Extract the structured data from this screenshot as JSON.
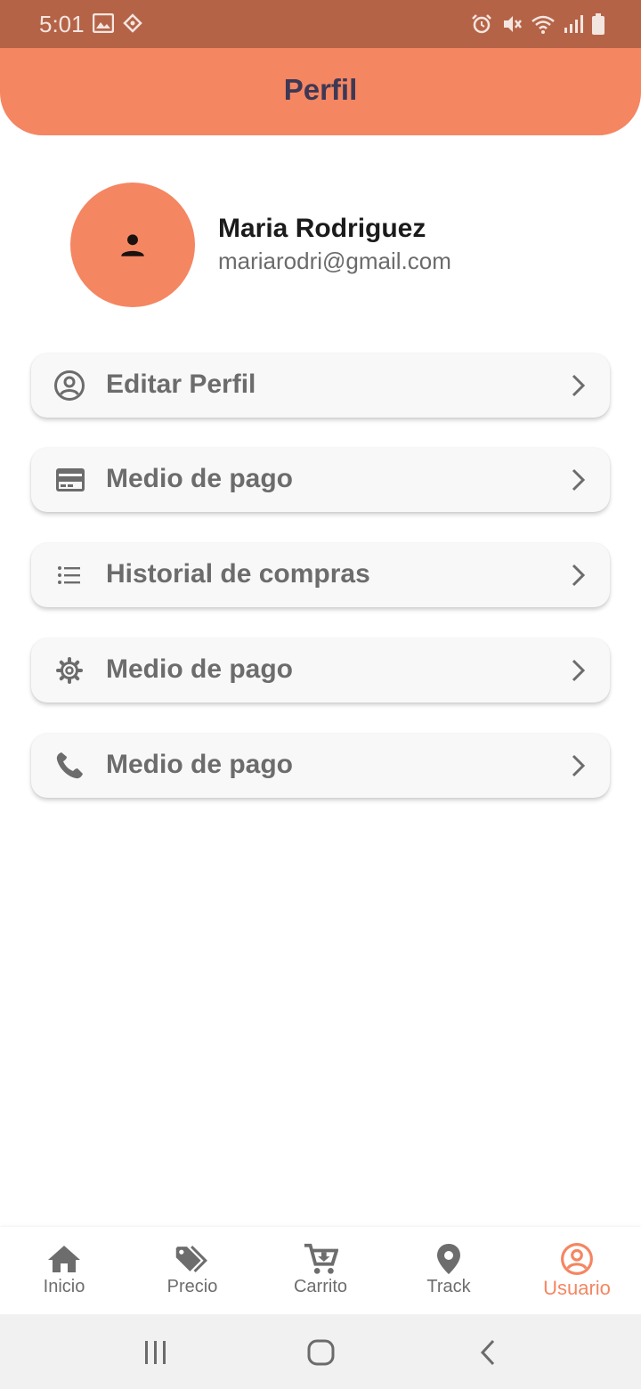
{
  "status_bar": {
    "time": "5:01",
    "left_icons": [
      "image-icon",
      "diamond-icon"
    ],
    "right_icons": [
      "alarm-icon",
      "mute-icon",
      "wifi-icon",
      "signal-icon",
      "battery-icon"
    ]
  },
  "header": {
    "title": "Perfil"
  },
  "profile": {
    "name": "Maria Rodriguez",
    "email": "mariarodri@gmail.com",
    "avatar_icon": "person-icon"
  },
  "menu": [
    {
      "label": "Editar Perfil",
      "icon": "account-circle-icon"
    },
    {
      "label": "Medio de pago",
      "icon": "credit-card-icon"
    },
    {
      "label": "Historial de compras",
      "icon": "list-icon"
    },
    {
      "label": "Medio de pago",
      "icon": "gear-icon"
    },
    {
      "label": "Medio de pago",
      "icon": "phone-icon"
    }
  ],
  "bottom_nav": [
    {
      "label": "Inicio",
      "icon": "home-icon",
      "active": false
    },
    {
      "label": "Precio",
      "icon": "tags-icon",
      "active": false
    },
    {
      "label": "Carrito",
      "icon": "cart-icon",
      "active": false
    },
    {
      "label": "Track",
      "icon": "location-pin-icon",
      "active": false
    },
    {
      "label": "Usuario",
      "icon": "account-circle-icon",
      "active": true
    }
  ],
  "colors": {
    "status_bar": "#b56347",
    "accent": "#f48662",
    "title_text": "#3d3854",
    "menu_text": "#6c6c6c"
  }
}
